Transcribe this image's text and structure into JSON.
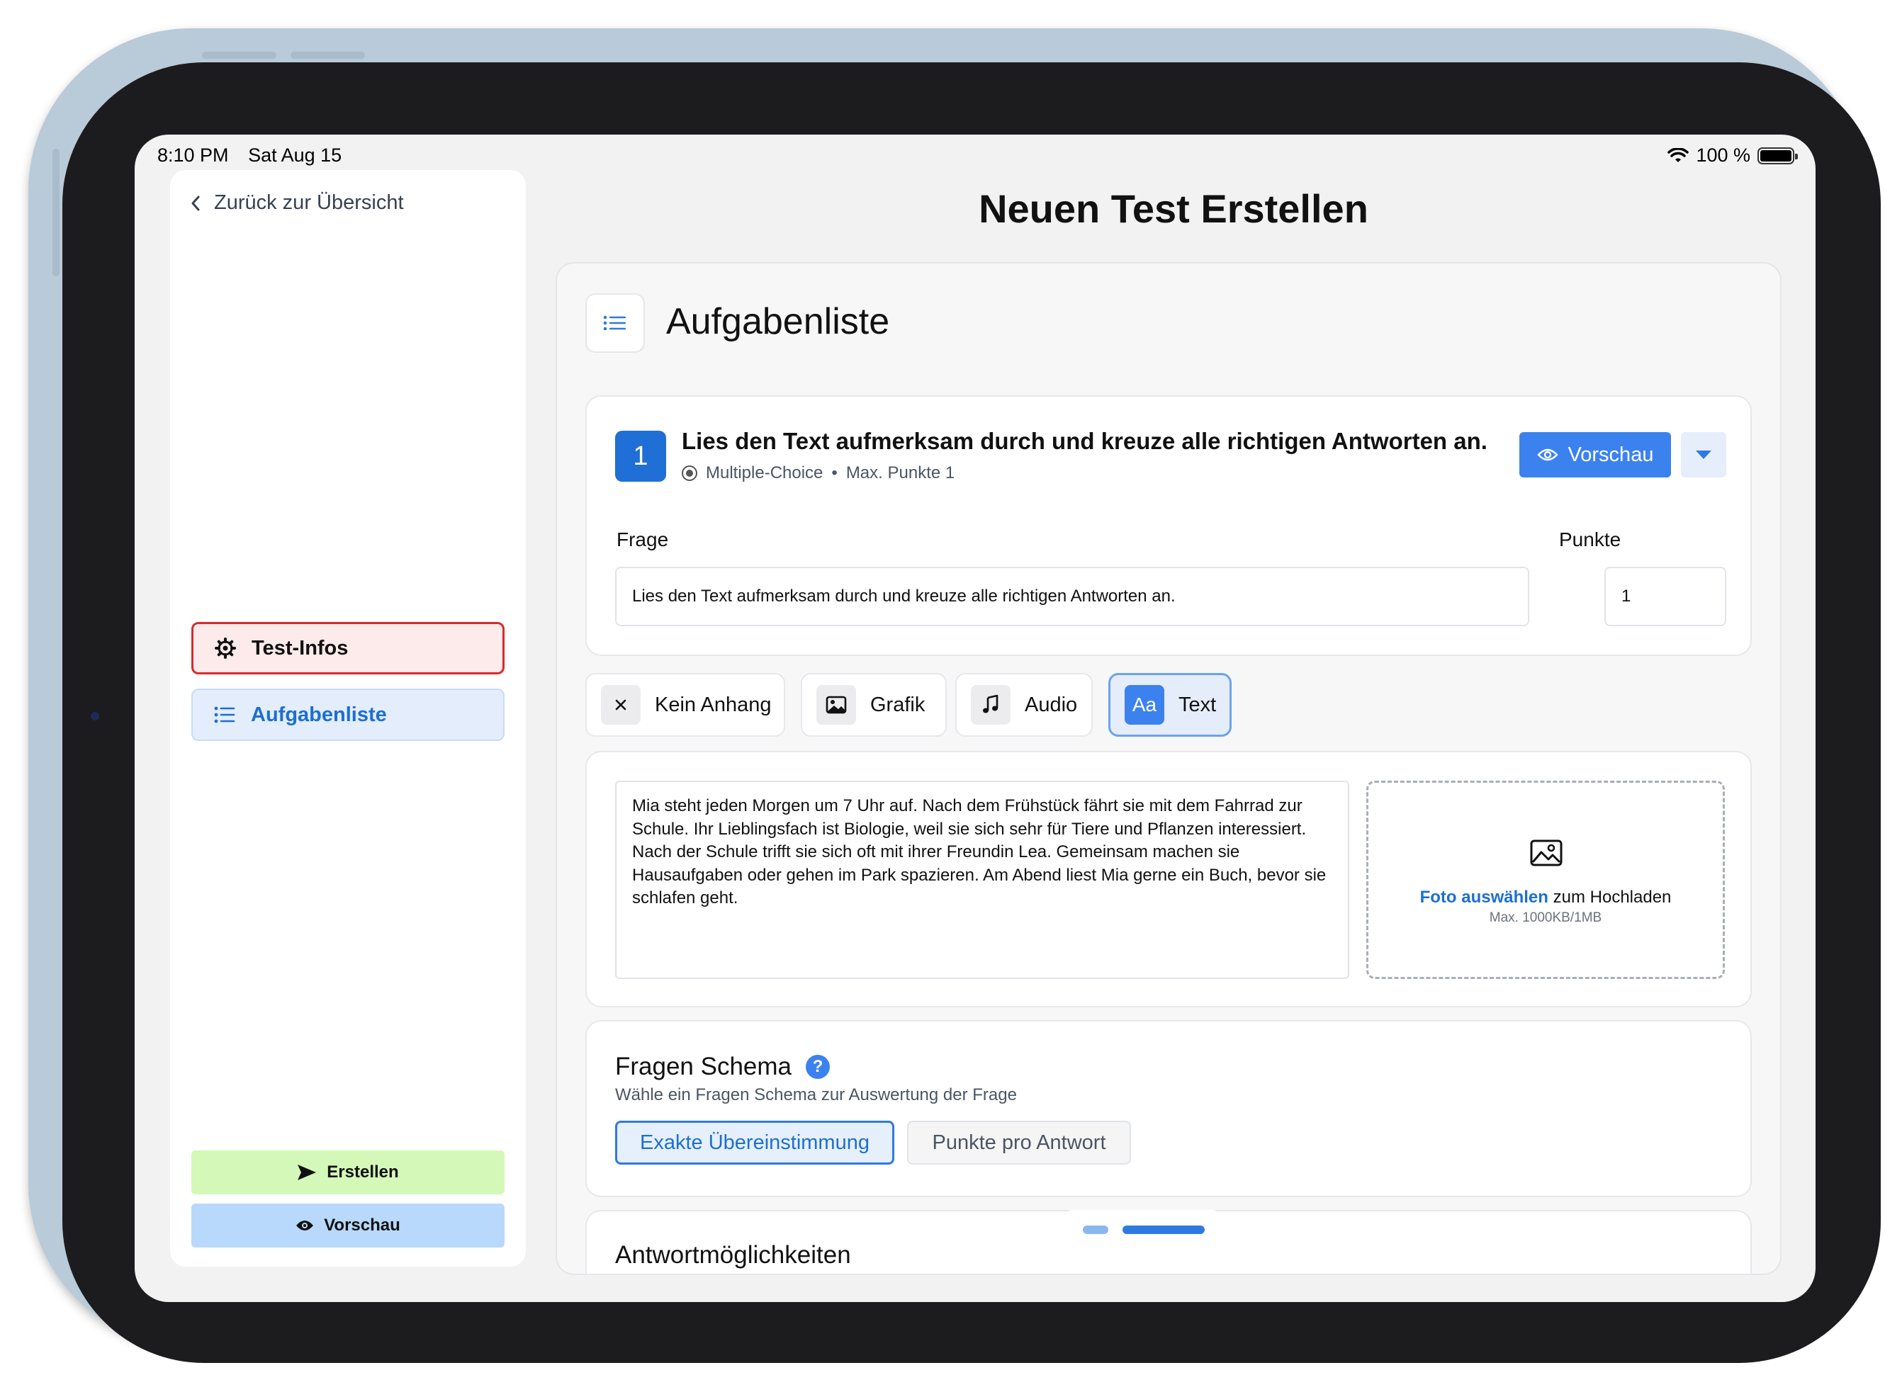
{
  "status_bar": {
    "time": "8:10 PM",
    "date": "Sat Aug 15",
    "battery": "100 %"
  },
  "sidebar": {
    "back_label": "Zurück zur Übersicht",
    "items": [
      {
        "label": "Test-Infos",
        "icon": "gear-icon"
      },
      {
        "label": "Aufgabenliste",
        "icon": "list-icon"
      }
    ],
    "create_label": "Erstellen",
    "preview_label": "Vorschau"
  },
  "page": {
    "title": "Neuen Test Erstellen",
    "section_title": "Aufgabenliste"
  },
  "question": {
    "number": "1",
    "title": "Lies den Text aufmerksam durch und kreuze alle richtigen Antworten an.",
    "type": "Multiple-Choice",
    "separator": "•",
    "max_points": "Max. Punkte 1",
    "preview_label": "Vorschau",
    "question_label": "Frage",
    "question_value": "Lies den Text aufmerksam durch und kreuze alle richtigen Antworten an.",
    "points_label": "Punkte",
    "points_value": "1"
  },
  "attachments": [
    {
      "label": "Kein Anhang",
      "icon": "close-icon",
      "active": false
    },
    {
      "label": "Grafik",
      "icon": "image-icon",
      "active": false
    },
    {
      "label": "Audio",
      "icon": "music-note-icon",
      "active": false
    },
    {
      "label": "Text",
      "icon": "text-icon",
      "glyph": "Aa",
      "active": true
    }
  ],
  "text_attachment": {
    "content": "Mia steht jeden Morgen um 7 Uhr auf. Nach dem Frühstück fährt sie mit dem Fahrrad zur Schule. Ihr Lieblingsfach ist Biologie, weil sie sich sehr für Tiere und Pflanzen interessiert. Nach der Schule trifft sie sich oft mit ihrer Freundin Lea. Gemeinsam machen sie Hausaufgaben oder gehen im Park spazieren. Am Abend liest Mia gerne ein Buch, bevor sie schlafen geht.",
    "upload_link": "Foto auswählen",
    "upload_text": "zum Hochladen",
    "upload_limit": "Max. 1000KB/1MB"
  },
  "schema": {
    "title": "Fragen Schema",
    "help": "?",
    "subtitle": "Wähle ein Fragen Schema zur Auswertung der Frage",
    "options": [
      {
        "label": "Exakte Übereinstimmung",
        "active": true
      },
      {
        "label": "Punkte pro Antwort",
        "active": false
      }
    ]
  },
  "answers": {
    "title": "Antwortmöglichkeiten"
  },
  "colors": {
    "accent": "#3b82ef",
    "danger": "#d62c2c",
    "success_bg": "#d4f8b8",
    "info_bg": "#b8d9fb"
  }
}
